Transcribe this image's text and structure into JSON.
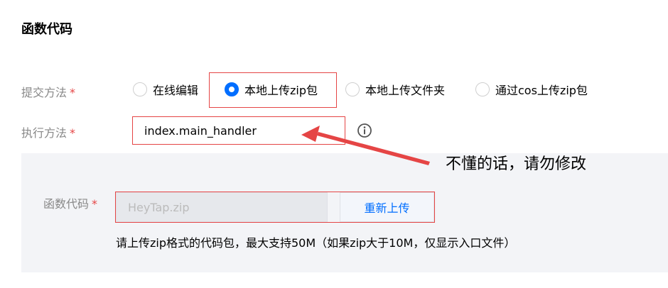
{
  "section_title": "函数代码",
  "submit_method": {
    "label": "提交方法",
    "required_mark": "*",
    "options": [
      {
        "label": "在线编辑",
        "checked": false
      },
      {
        "label": "本地上传zip包",
        "checked": true
      },
      {
        "label": "本地上传文件夹",
        "checked": false
      },
      {
        "label": "通过cos上传zip包",
        "checked": false
      }
    ]
  },
  "exec_method": {
    "label": "执行方法",
    "required_mark": "*",
    "value": "index.main_handler",
    "info_icon": "info-circle-icon"
  },
  "function_code": {
    "label": "函数代码",
    "required_mark": "*",
    "file_name": "HeyTap.zip",
    "reupload_label": "重新上传",
    "hint": "请上传zip格式的代码包，最大支持50M（如果zip大于10M，仅显示入口文件）"
  },
  "annotation": {
    "text": "不懂的话，请勿修改"
  },
  "colors": {
    "accent": "#006eff",
    "highlight_red": "#e54545",
    "panel_bg": "#f3f4f7"
  }
}
